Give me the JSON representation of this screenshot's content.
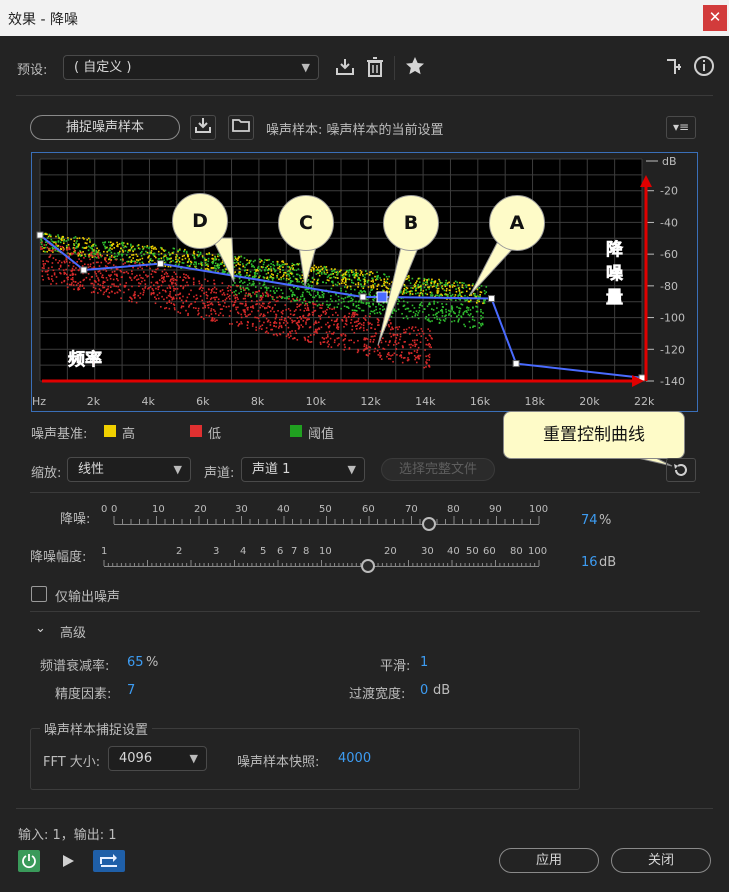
{
  "window": {
    "title": "效果 - 降噪",
    "close_glyph": "✕"
  },
  "preset": {
    "label": "预设:",
    "value": "( 自定义 )"
  },
  "capture": {
    "button_label": "捕捉噪声样本",
    "sample_text": "噪声样本: 噪声样本的当前设置"
  },
  "graph": {
    "db_unit": "dB",
    "db_ticks": [
      "-20",
      "-40",
      "-60",
      "-80",
      "-100",
      "-120",
      "-140"
    ],
    "freq_ticks": [
      "Hz",
      "2k",
      "4k",
      "6k",
      "8k",
      "10k",
      "12k",
      "14k",
      "16k",
      "18k",
      "20k",
      "22k"
    ],
    "annotation_freq": "频率",
    "annotation_reduce": [
      "降",
      "噪",
      "量"
    ],
    "callouts": [
      "D",
      "C",
      "B",
      "A"
    ]
  },
  "legend": {
    "label": "噪声基准:",
    "items": [
      {
        "label": "高",
        "color": "#f0d000"
      },
      {
        "label": "低",
        "color": "#e03030"
      },
      {
        "label": "阈值",
        "color": "#20a020"
      }
    ]
  },
  "scale": {
    "label": "缩放:",
    "value": "线性"
  },
  "channel": {
    "label": "声道:",
    "value": "声道 1"
  },
  "select_file_label": "选择完整文件",
  "reset_tooltip": "重置控制曲线",
  "noise_reduction": {
    "label": "降噪:",
    "ticks": [
      "0",
      "0",
      "10",
      "20",
      "30",
      "40",
      "50",
      "60",
      "70",
      "80",
      "90",
      "100"
    ],
    "value": "74",
    "unit": "%",
    "fraction": 0.74
  },
  "reduce_by": {
    "label": "降噪幅度:",
    "ticks": [
      "1",
      "2",
      "3",
      "4",
      "5",
      "6",
      "7",
      "8",
      "10",
      "20",
      "30",
      "40",
      "50",
      "60",
      "80",
      "100"
    ],
    "value": "16",
    "unit": "dB"
  },
  "output_noise_only": {
    "label": "仅输出噪声",
    "checked": false
  },
  "advanced": {
    "label": "高级",
    "spectral_decay_label": "频谱衰减率:",
    "spectral_decay_value": "65",
    "spectral_decay_unit": "%",
    "smoothing_label": "平滑:",
    "smoothing_value": "1",
    "precision_label": "精度因素:",
    "precision_value": "7",
    "transition_label": "过渡宽度:",
    "transition_value": "0",
    "transition_unit": "dB"
  },
  "capture_settings": {
    "title": "噪声样本捕捉设置",
    "fft_label": "FFT 大小:",
    "fft_value": "4096",
    "snapshots_label": "噪声样本快照:",
    "snapshots_value": "4000"
  },
  "io": "输入: 1，输出: 1",
  "buttons": {
    "apply": "应用",
    "close": "关闭"
  }
}
